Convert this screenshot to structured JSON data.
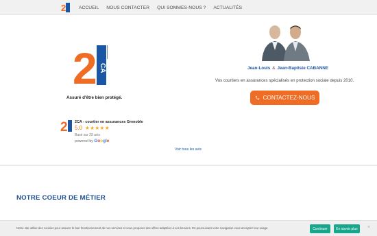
{
  "nav": {
    "items": [
      {
        "label": "ACCUEIL"
      },
      {
        "label": "NOUS CONTACTER"
      },
      {
        "label": "QUI SOMMES-NOUS ?"
      },
      {
        "label": "ACTUALITÉS"
      }
    ]
  },
  "brand": {
    "logo_lettering": "2CA",
    "tagline": "Assuré d'être bien protégé.",
    "colors": {
      "orange": "#ee6c24",
      "blue": "#1b56a6"
    }
  },
  "team": {
    "name1": "Jean-Louis",
    "amp": "&",
    "name2": "Jean-Baptiste CABANNE",
    "description": "Vos courtiers en assurances spécialisés en protection sociale depuis 2010.",
    "contact_label": "CONTACTEZ-NOUS",
    "contact_icon": "phone-icon"
  },
  "review": {
    "business_name": "2CA - courtier en assurances Grenoble",
    "score": "5.0",
    "stars": "★★★★★",
    "basis": "Basé sur 29 avis",
    "powered_by": "powered by",
    "provider": "Google",
    "see_all": "Voir tous les avis"
  },
  "section": {
    "title": "NOTRE COEUR DE MÉTIER"
  },
  "cookie": {
    "text": "Notre site utilise des cookies pour assurer le bon fonctionnement de nos services et vous proposer des offres adaptées à vos besoins. En poursuivant votre navigation vous acceptez leur usage.",
    "continue_label": "Continuer",
    "more_label": "En savoir plus",
    "close_label": "×"
  }
}
